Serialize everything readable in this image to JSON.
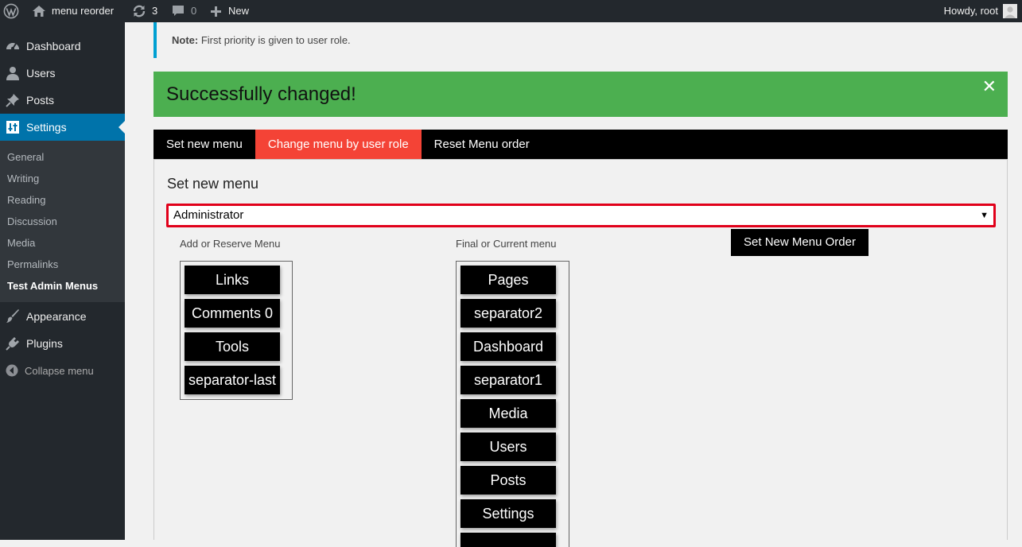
{
  "adminbar": {
    "site_name": "menu reorder",
    "updates_count": "3",
    "comments_count": "0",
    "new_label": "New",
    "howdy": "Howdy, root"
  },
  "adminmenu": {
    "top_items": [
      {
        "label": "Dashboard",
        "icon": "dashboard-icon"
      },
      {
        "label": "Users",
        "icon": "users-icon"
      },
      {
        "label": "Posts",
        "icon": "pushpin-icon"
      },
      {
        "label": "Settings",
        "icon": "settings-icon"
      },
      {
        "label": "Appearance",
        "icon": "paintbrush-icon"
      },
      {
        "label": "Plugins",
        "icon": "plugin-icon"
      }
    ],
    "submenu": [
      "General",
      "Writing",
      "Reading",
      "Discussion",
      "Media",
      "Permalinks",
      "Test Admin Menus"
    ],
    "collapse_label": "Collapse menu"
  },
  "notice": {
    "strong": "Note:",
    "text": " First priority is given to user role."
  },
  "success": {
    "message": "Successfully changed!",
    "close_glyph": "✕"
  },
  "tabs": [
    "Set new menu",
    "Change menu by user role",
    "Reset Menu order"
  ],
  "panel": {
    "title": "Set new menu",
    "role_selected": "Administrator",
    "reserve_label": "Add or Reserve Menu",
    "current_label": "Final or Current menu",
    "set_button": "Set New Menu Order",
    "reserve_items": [
      "Links",
      "Comments 0",
      "Tools",
      "separator-last"
    ],
    "current_items": [
      "Pages",
      "separator2",
      "Dashboard",
      "separator1",
      "Media",
      "Users",
      "Posts",
      "Settings"
    ]
  },
  "colors": {
    "admin_bg": "#23282d",
    "accent_blue": "#0073aa",
    "success_green": "#4caf50",
    "active_tab_red": "#f44336",
    "select_border": "#e1001a"
  }
}
